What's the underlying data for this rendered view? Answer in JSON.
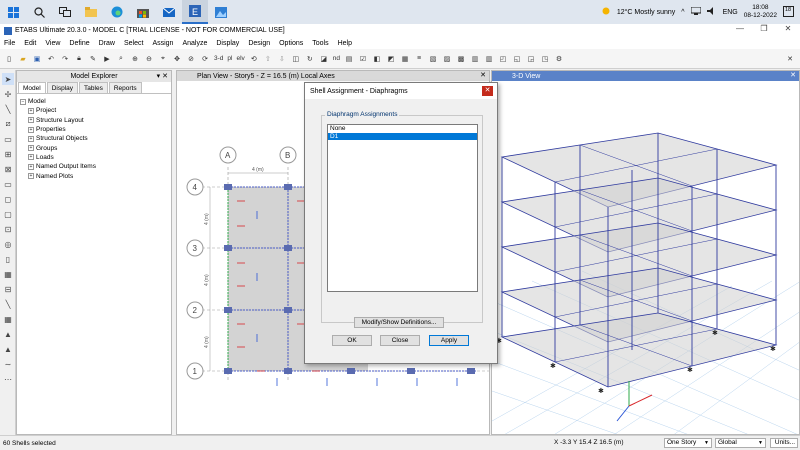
{
  "taskbar": {
    "weather": "12°C  Mostly sunny",
    "lang": "ENG",
    "time": "18:08",
    "date": "08-12-2022",
    "notif_count": "18"
  },
  "window": {
    "title": "ETABS Ultimate 20.3.0 - MODEL C  [TRIAL LICENSE - NOT FOR COMMERCIAL USE]"
  },
  "menu": [
    "File",
    "Edit",
    "View",
    "Define",
    "Draw",
    "Select",
    "Assign",
    "Analyze",
    "Display",
    "Design",
    "Options",
    "Tools",
    "Help"
  ],
  "toolbar": {
    "three_d": "3-d",
    "plan": "pl",
    "elev": "elv",
    "nd": "nd"
  },
  "explorer": {
    "title": "Model Explorer",
    "tabs": [
      "Model",
      "Display",
      "Tables",
      "Reports"
    ],
    "root": "Model",
    "items": [
      "Project",
      "Structure Layout",
      "Properties",
      "Structural Objects",
      "Groups",
      "Loads",
      "Named Output Items",
      "Named Plots"
    ]
  },
  "plan_view": {
    "title": "Plan View - Story5 - Z = 16.5 (m)  Local Axes",
    "grid_cols": [
      "A",
      "B"
    ],
    "grid_rows": [
      "4",
      "3",
      "2",
      "1"
    ],
    "dim_x": "4 (m)",
    "dim_y": [
      "4 (m)",
      "4 (m)",
      "4 (m)"
    ]
  },
  "view3d": {
    "title": "3-D View"
  },
  "dialog": {
    "title": "Shell Assignment - Diaphragms",
    "group_label": "Diaphragm Assignments",
    "options": [
      "None",
      "D1"
    ],
    "selected": "D1",
    "modify_btn": "Modify/Show Definitions...",
    "ok_btn": "OK",
    "close_btn": "Close",
    "apply_btn": "Apply"
  },
  "status": {
    "selection": "60 Shells selected",
    "coords": "X -3.3  Y 15.4  Z 16.5 (m)",
    "story_mode": "One Story",
    "coord_sys": "Global",
    "units": "Units..."
  },
  "colors": {
    "accent": "#0078d7",
    "view_header_active": "#5a82c8",
    "frame": "#2f3a9e",
    "slab": "#d3d3d3"
  }
}
